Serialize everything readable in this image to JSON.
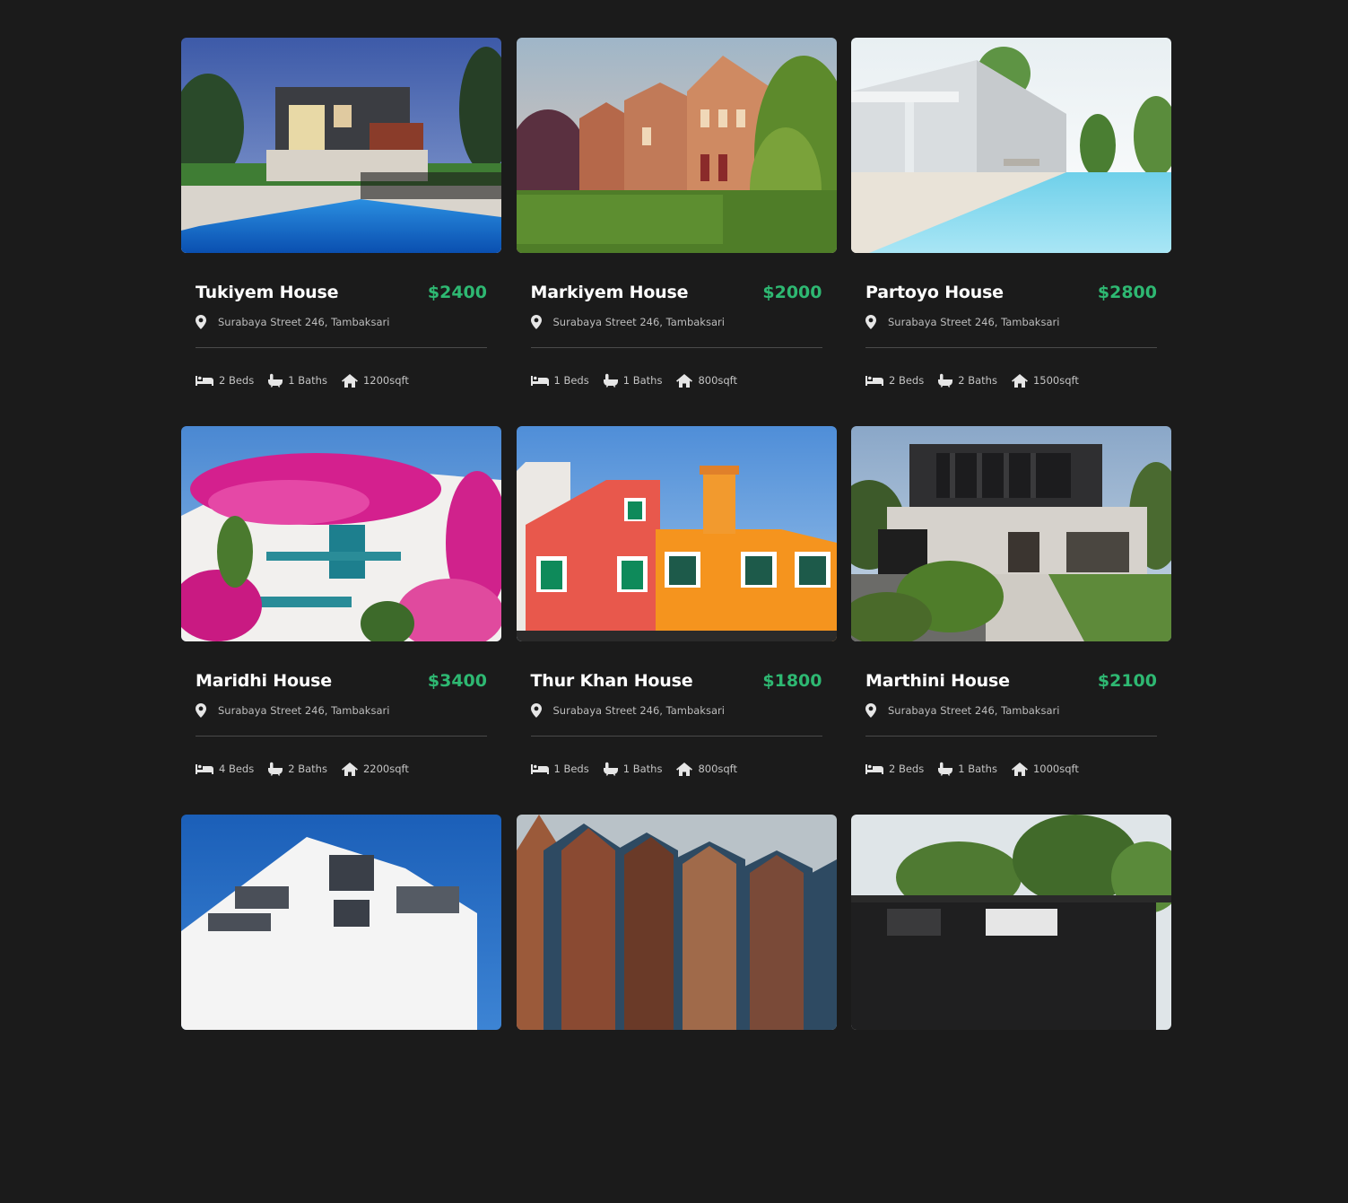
{
  "listings": [
    {
      "name": "Tukiyem House",
      "price": "$2400",
      "address": "Surabaya Street 246, Tambaksari",
      "beds": "2 Beds",
      "baths": "1 Baths",
      "area": "1200sqft",
      "photo": "modern-house-with-pool"
    },
    {
      "name": "Markiyem House",
      "price": "$2000",
      "address": "Surabaya Street 246, Tambaksari",
      "beds": "1 Beds",
      "baths": "1 Baths",
      "area": "800sqft",
      "photo": "brick-townhouses"
    },
    {
      "name": "Partoyo House",
      "price": "$2800",
      "address": "Surabaya Street 246, Tambaksari",
      "beds": "2 Beds",
      "baths": "2 Baths",
      "area": "1500sqft",
      "photo": "white-villa-with-pool"
    },
    {
      "name": "Maridhi House",
      "price": "$3400",
      "address": "Surabaya Street 246, Tambaksari",
      "beds": "4 Beds",
      "baths": "2 Baths",
      "area": "2200sqft",
      "photo": "bougainvillea-house"
    },
    {
      "name": "Thur Khan House",
      "price": "$1800",
      "address": "Surabaya Street 246, Tambaksari",
      "beds": "1 Beds",
      "baths": "1 Baths",
      "area": "800sqft",
      "photo": "colorful-burano-houses"
    },
    {
      "name": "Marthini House",
      "price": "$2100",
      "address": "Surabaya Street 246, Tambaksari",
      "beds": "2 Beds",
      "baths": "1 Baths",
      "area": "1000sqft",
      "photo": "dark-modern-house"
    }
  ],
  "partial_listings": [
    {
      "photo": "white-apartment-building"
    },
    {
      "photo": "gabled-brick-roofs"
    },
    {
      "photo": "black-bungalow"
    }
  ],
  "colors": {
    "background": "#1b1b1b",
    "price": "#2eb872",
    "title": "#ffffff",
    "muted": "#bdbdbd",
    "divider": "#4a4a4a"
  },
  "icons": {
    "location": "map-pin-icon",
    "beds": "bed-icon",
    "baths": "bathtub-icon",
    "area": "house-icon"
  }
}
